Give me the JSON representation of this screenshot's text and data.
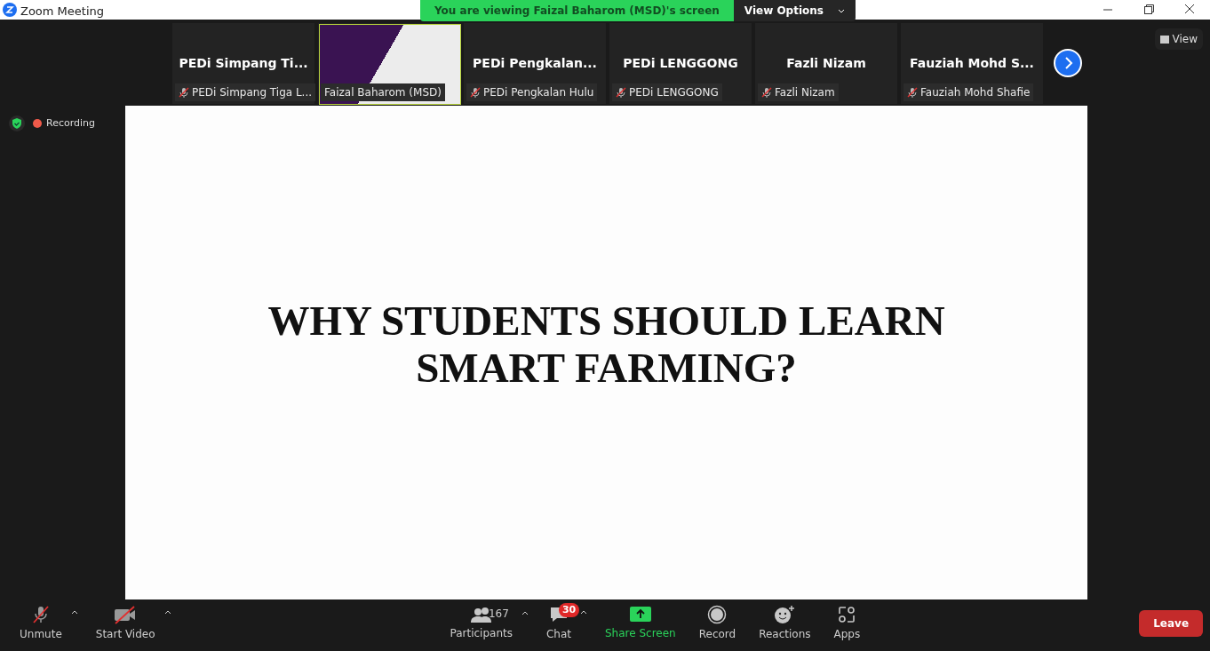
{
  "window": {
    "title": "Zoom Meeting"
  },
  "share_banner": {
    "text": "You are viewing Faizal Baharom (MSD)'s screen",
    "options_label": "View Options"
  },
  "tiles": [
    {
      "kind": "name",
      "display": "PEDi  Simpang  Ti...",
      "label": "PEDi Simpang Tiga L...",
      "muted": true,
      "selected": false
    },
    {
      "kind": "video",
      "label": "Faizal Baharom (MSD)",
      "muted": false,
      "selected": true
    },
    {
      "kind": "name",
      "display": "PEDi  Pengkalan...",
      "label": "PEDi Pengkalan Hulu",
      "muted": true,
      "selected": false
    },
    {
      "kind": "name",
      "display": "PEDi LENGGONG",
      "label": "PEDi LENGGONG",
      "muted": true,
      "selected": false
    },
    {
      "kind": "name",
      "display": "Fazli Nizam",
      "label": "Fazli Nizam",
      "muted": true,
      "selected": false
    },
    {
      "kind": "name",
      "display": "Fauziah  Mohd  S...",
      "label": "Fauziah Mohd Shafie",
      "muted": true,
      "selected": false
    }
  ],
  "view_button": "View",
  "recording": {
    "label": "Recording"
  },
  "slide": {
    "title": "WHY STUDENTS SHOULD LEARN SMART FARMING?"
  },
  "toolbar": [
    {
      "kind": "mic",
      "label": "Unmute",
      "caret": true,
      "off": true
    },
    {
      "kind": "video",
      "label": "Start Video",
      "caret": true,
      "off": true
    },
    {
      "kind": "spacer"
    },
    {
      "kind": "participants",
      "label": "Participants",
      "count": "167",
      "caret": true
    },
    {
      "kind": "chat",
      "label": "Chat",
      "badge": "30",
      "caret": true
    },
    {
      "kind": "share",
      "label": "Share Screen"
    },
    {
      "kind": "record",
      "label": "Record"
    },
    {
      "kind": "reactions",
      "label": "Reactions"
    },
    {
      "kind": "apps",
      "label": "Apps"
    },
    {
      "kind": "spacer"
    }
  ],
  "leave_button": "Leave"
}
